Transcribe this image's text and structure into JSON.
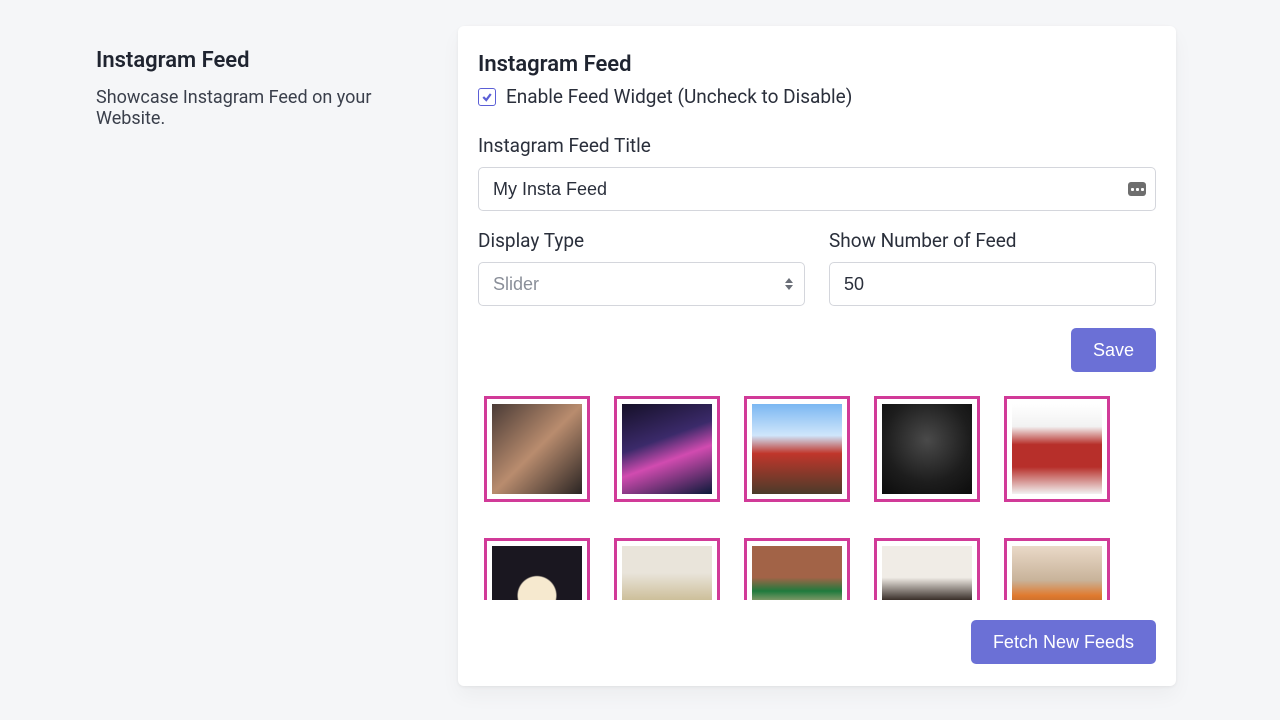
{
  "left": {
    "title": "Instagram Feed",
    "desc": "Showcase Instagram Feed on your Website."
  },
  "card": {
    "title": "Instagram Feed",
    "enable_label": "Enable Feed Widget (Uncheck to Disable)",
    "enable_checked": true,
    "title_label": "Instagram Feed Title",
    "title_value": "My Insta Feed",
    "display_type_label": "Display Type",
    "display_type_value": "Slider",
    "count_label": "Show Number of Feed",
    "count_value": "50",
    "save_label": "Save",
    "fetch_label": "Fetch New Feeds"
  },
  "colors": {
    "accent": "#6b70d6",
    "thumb_border": "#d13a98"
  }
}
